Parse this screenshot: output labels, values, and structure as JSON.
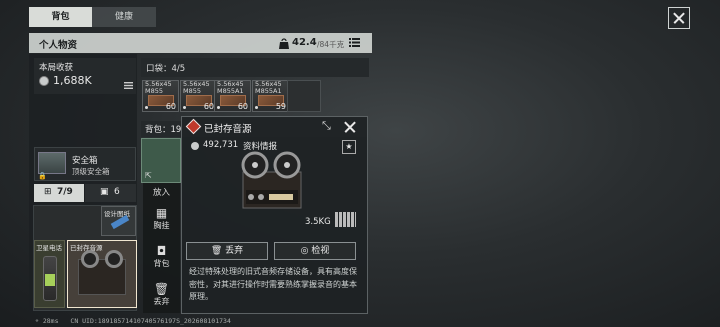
{
  "tabs": [
    "背包",
    "健康"
  ],
  "header": {
    "title": "个人物资",
    "weight_current": "42.4",
    "weight_max": "/84千克"
  },
  "earnings": {
    "label": "本局收获",
    "value": "1,688K"
  },
  "pouch": {
    "label": "口袋：4/5"
  },
  "ammo": [
    {
      "label_line1": "5.56x45",
      "label_line2": "M855",
      "count": "60"
    },
    {
      "label_line1": "5.56x45",
      "label_line2": "M855",
      "count": "60"
    },
    {
      "label_line1": "5.56x45",
      "label_line2": "M855A1",
      "count": "60"
    },
    {
      "label_line1": "5.56x45",
      "label_line2": "M855A1",
      "count": "59"
    }
  ],
  "backpack": {
    "label": "背包：19"
  },
  "safebox": {
    "title": "安全箱",
    "subtitle": "顶级安全箱"
  },
  "filter_tabs": [
    {
      "count": "7/9"
    },
    {
      "count": "6"
    }
  ],
  "items": {
    "design_doc": "设计图纸",
    "satellite_phone": "卫星电话",
    "tape": "已封存音源"
  },
  "actions": {
    "put_in": "放入",
    "chest_rig": "胸挂",
    "backpack": "背包",
    "discard": "丢弃"
  },
  "popup": {
    "title": "已封存音源",
    "price": "492,731",
    "category": "资料情报",
    "weight": "3.5KG",
    "discard_label": "丢弃",
    "inspect_label": "检视",
    "description": "经过特殊处理的旧式音频存储设备，具有高度保密性，对其进行操作时需要熟练掌握录音的基本原理。"
  },
  "status": {
    "ping": "28ms",
    "uid": "CN UID:18918571410740576197S_20260810173‍4"
  },
  "colors": {
    "accent_red": "#c0392b",
    "gold": "#d4a84a",
    "panel": "#1c2022"
  }
}
